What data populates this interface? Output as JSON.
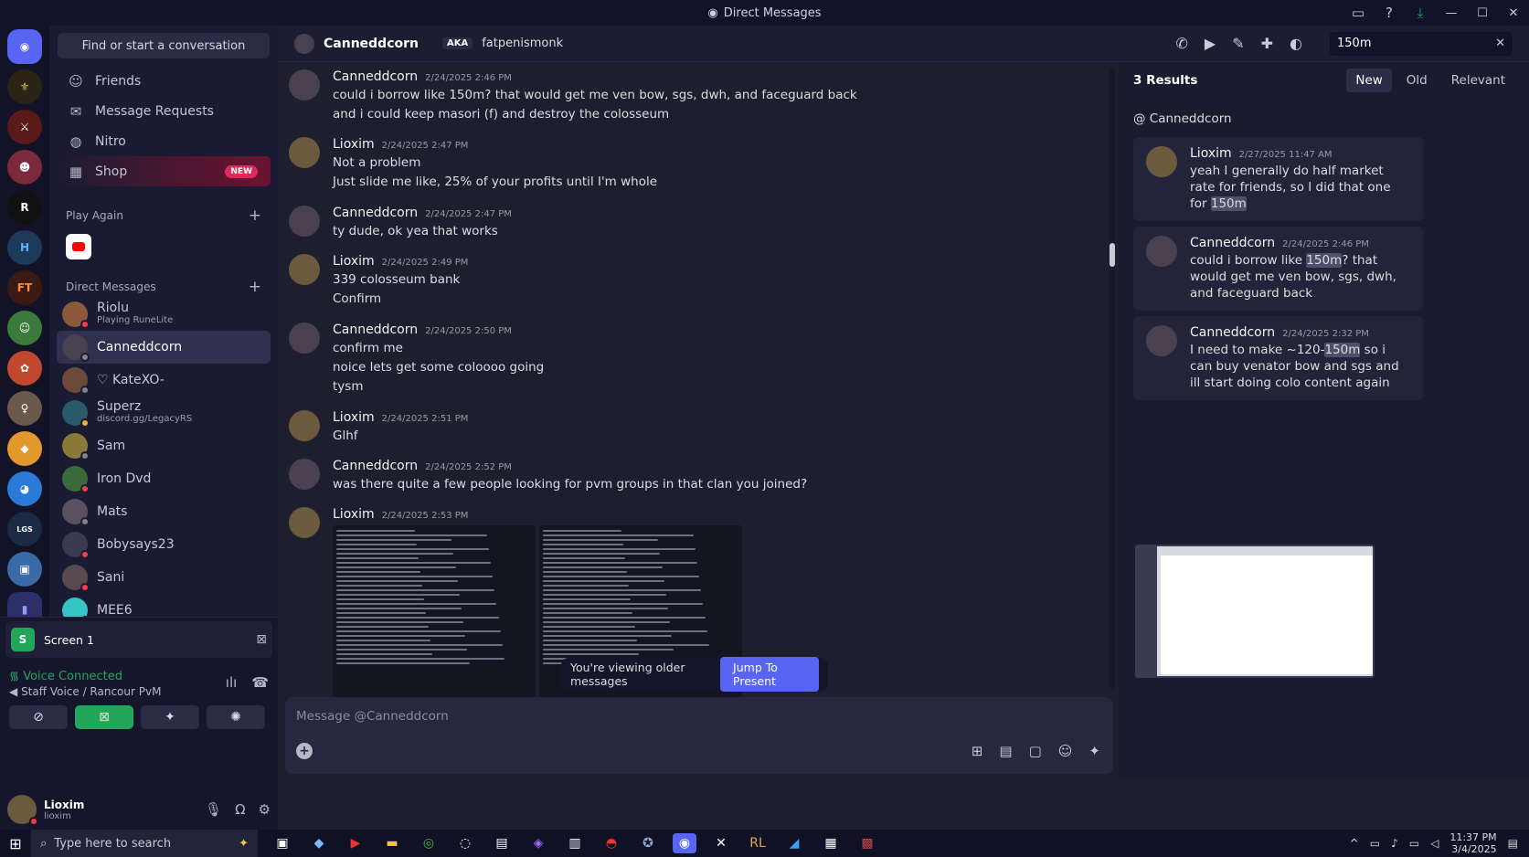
{
  "window": {
    "title": "Direct Messages"
  },
  "colors": {
    "accent": "#5865f2",
    "online": "#23a55a",
    "dnd": "#f23f43",
    "new_badge": "#e0285a"
  },
  "dm_sidebar": {
    "search_label": "Find or start a conversation",
    "nav": [
      {
        "label": "Friends",
        "icon": "friends-icon"
      },
      {
        "label": "Message Requests",
        "icon": "mail-icon"
      },
      {
        "label": "Nitro",
        "icon": "nitro-icon"
      },
      {
        "label": "Shop",
        "icon": "shop-icon",
        "badge": "NEW"
      }
    ],
    "play_again_label": "Play Again",
    "direct_messages_label": "Direct Messages",
    "dms": [
      {
        "name": "Riolu",
        "sub": "Playing RuneLite",
        "status": "dnd"
      },
      {
        "name": "Canneddcorn",
        "sub": "",
        "status": "offline"
      },
      {
        "name": "♡ KateXO-",
        "sub": "",
        "status": "offline"
      },
      {
        "name": "Superz",
        "sub": "discord.gg/LegacyRS",
        "status": "idle"
      },
      {
        "name": "Sam",
        "sub": "",
        "status": "offline"
      },
      {
        "name": "Iron Dvd",
        "sub": "",
        "status": "dnd"
      },
      {
        "name": "Mats",
        "sub": "",
        "status": "offline"
      },
      {
        "name": "Bobysays23",
        "sub": "",
        "status": "dnd"
      },
      {
        "name": "Sani",
        "sub": "",
        "status": "dnd"
      },
      {
        "name": "MEE6",
        "sub": "",
        "status": "offline"
      }
    ]
  },
  "voice": {
    "screen_label": "Screen 1",
    "status": "Voice Connected",
    "channel": "Staff Voice / Rancour PvM"
  },
  "user": {
    "name": "Lioxim",
    "tag": "lioxim"
  },
  "header": {
    "name": "Canneddcorn",
    "aka": "AKA",
    "aka_name": "fatpenismonk",
    "search_value": "150m"
  },
  "messages": [
    {
      "author": "Canneddcorn",
      "time": "2/24/2025 2:46 PM",
      "lines": [
        "could i borrow like 150m? that would get me ven bow, sgs, dwh, and faceguard back",
        "and i could keep masori (f) and destroy the colosseum"
      ]
    },
    {
      "author": "Lioxim",
      "time": "2/24/2025 2:47 PM",
      "lines": [
        "Not a problem",
        "Just slide me like, 25% of your profits until I'm whole"
      ]
    },
    {
      "author": "Canneddcorn",
      "time": "2/24/2025 2:47 PM",
      "lines": [
        "ty dude, ok yea that works"
      ]
    },
    {
      "author": "Lioxim",
      "time": "2/24/2025 2:49 PM",
      "lines": [
        "339 colosseum bank",
        "Confirm"
      ]
    },
    {
      "author": "Canneddcorn",
      "time": "2/24/2025 2:50 PM",
      "lines": [
        "confirm me",
        "noice lets get some coloooo going",
        "tysm"
      ]
    },
    {
      "author": "Lioxim",
      "time": "2/24/2025 2:51 PM",
      "lines": [
        "Glhf"
      ]
    },
    {
      "author": "Canneddcorn",
      "time": "2/24/2025 2:52 PM",
      "lines": [
        "was there quite a few people looking for pvm groups in that clan you joined?"
      ]
    },
    {
      "author": "Lioxim",
      "time": "2/24/2025 2:53 PM",
      "lines": []
    }
  ],
  "older_banner": {
    "text": "You're viewing older messages",
    "button": "Jump To Present"
  },
  "composer": {
    "placeholder": "Message @Canneddcorn"
  },
  "results": {
    "count": "3 Results",
    "tabs": [
      "New",
      "Old",
      "Relevant"
    ],
    "group": "@ Canneddcorn",
    "items": [
      {
        "author": "Lioxim",
        "time": "2/27/2025 11:47 AM",
        "pre": "yeah I generally do half market rate for friends, so I did that one for ",
        "hl": "150m",
        "post": ""
      },
      {
        "author": "Canneddcorn",
        "time": "2/24/2025 2:46 PM",
        "pre": "could i borrow like ",
        "hl": "150m",
        "post": "? that would get me ven bow, sgs, dwh, and faceguard back"
      },
      {
        "author": "Canneddcorn",
        "time": "2/24/2025 2:32 PM",
        "pre": "I need to make ~120-",
        "hl": "150m",
        "post": " so i can buy venator bow and sgs and ill start doing colo content again"
      }
    ]
  },
  "taskbar": {
    "search_placeholder": "Type here to search",
    "time": "11:37 PM",
    "date": "3/4/2025"
  }
}
